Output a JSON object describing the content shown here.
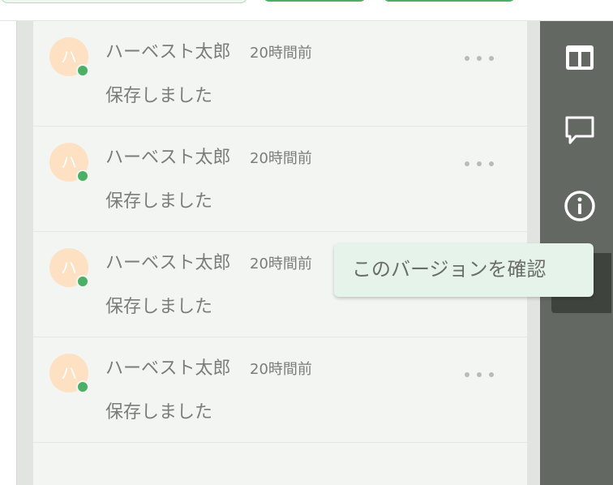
{
  "versions": [
    {
      "avatar_initial": "ハ",
      "name": "ハーベスト太郎",
      "time": "20時間前",
      "message": "保存しました"
    },
    {
      "avatar_initial": "ハ",
      "name": "ハーベスト太郎",
      "time": "20時間前",
      "message": "保存しました"
    },
    {
      "avatar_initial": "ハ",
      "name": "ハーベスト太郎",
      "time": "20時間前",
      "message": "保存しました"
    },
    {
      "avatar_initial": "ハ",
      "name": "ハーベスト太郎",
      "time": "20時間前",
      "message": "保存しました"
    }
  ],
  "tooltip": {
    "text": "このバージョンを確認"
  },
  "sidebar": {
    "icons": [
      "layout-columns-icon",
      "comment-icon",
      "info-icon",
      "history-icon"
    ]
  },
  "colors": {
    "accent": "#4caf66",
    "sidebar": "#636863",
    "avatar_bg": "#fde1c2",
    "tooltip_bg": "#e6f3ea"
  }
}
